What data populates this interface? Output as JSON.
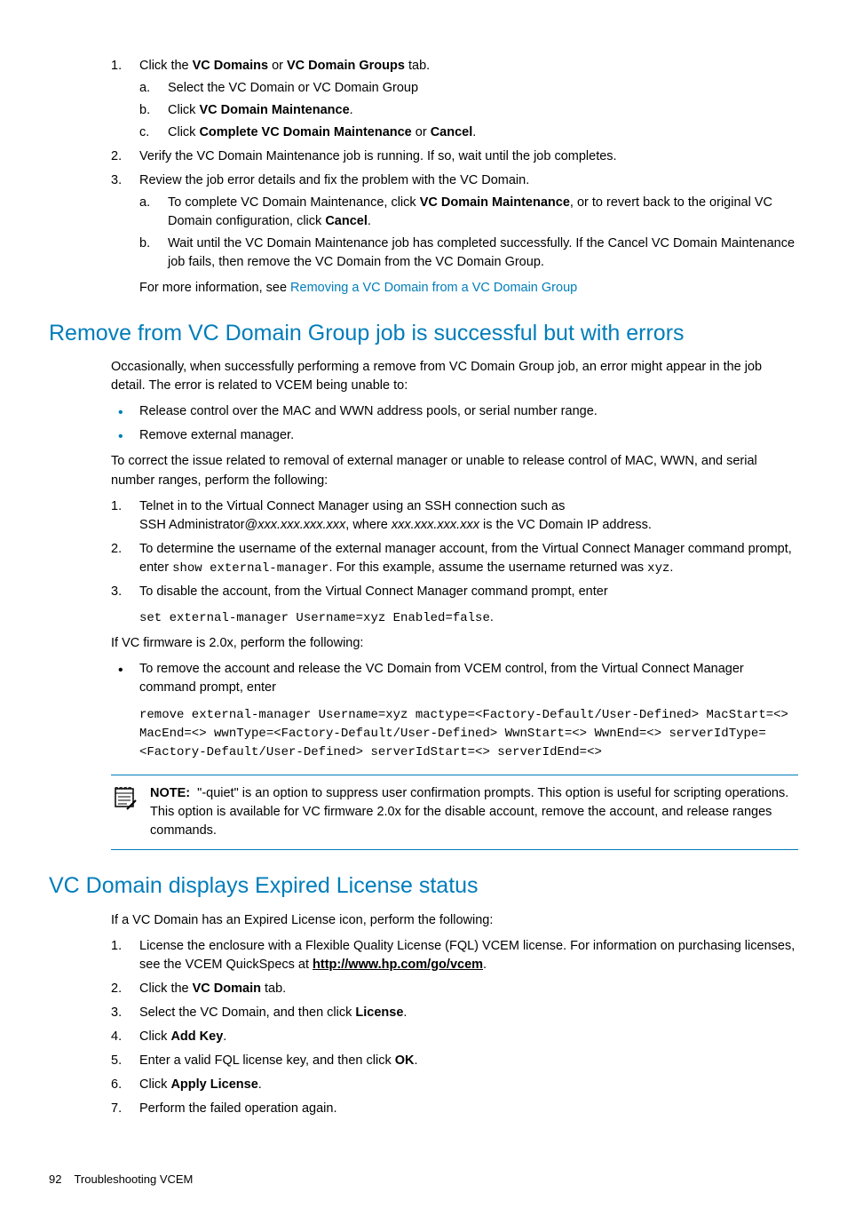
{
  "step1": {
    "text_a": "Click the ",
    "b1": "VC Domains",
    "text_b": " or ",
    "b2": "VC Domain Groups",
    "text_c": " tab.",
    "sub_a": "Select the VC Domain or VC Domain Group",
    "sub_b_a": "Click ",
    "sub_b_b": "VC Domain Maintenance",
    "sub_b_c": ".",
    "sub_c_a": "Click ",
    "sub_c_b": "Complete VC Domain Maintenance",
    "sub_c_c": " or ",
    "sub_c_d": "Cancel",
    "sub_c_e": "."
  },
  "step2": "Verify the VC Domain Maintenance job is running. If so, wait until the job completes.",
  "step3": {
    "text": "Review the job error details and fix the problem with the VC Domain.",
    "sub_a_a": "To complete VC Domain Maintenance, click ",
    "sub_a_b": "VC Domain Maintenance",
    "sub_a_c": ", or to revert back to the original VC Domain configuration, click ",
    "sub_a_d": "Cancel",
    "sub_a_e": ".",
    "sub_b": "Wait until the VC Domain Maintenance job has completed successfully. If the Cancel VC Domain Maintenance job fails, then remove the VC Domain from the VC Domain Group.",
    "moreinfo_a": "For more information, see ",
    "moreinfo_link": "Removing a VC Domain from a VC Domain Group"
  },
  "h_remove": "Remove from VC Domain Group job is successful but with errors",
  "remove_intro": "Occasionally, when successfully performing a remove from VC Domain Group job, an error might appear in the job detail. The error is related to VCEM being unable to:",
  "remove_b1": "Release control over the MAC and WWN address pools, or serial number range.",
  "remove_b2": "Remove external manager.",
  "remove_correct": "To correct the issue related to removal of external manager or unable to release control of MAC, WWN, and serial number ranges, perform the following:",
  "rstep1_a": "Telnet in to the Virtual Connect Manager using an SSH connection such as",
  "rstep1_b": "SSH Administrator@",
  "rstep1_c": "xxx.xxx.xxx.xxx",
  "rstep1_d": ", where ",
  "rstep1_e": "xxx.xxx.xxx.xxx",
  "rstep1_f": " is the VC Domain IP address.",
  "rstep2_a": "To determine the username of the external manager account, from the Virtual Connect Manager command prompt, enter ",
  "rstep2_b": "show external-manager",
  "rstep2_c": ". For this example, assume the username returned was ",
  "rstep2_d": "xyz",
  "rstep2_e": ".",
  "rstep3": "To disable the account, from the Virtual Connect Manager command prompt, enter",
  "rstep3_code": "set external-manager Username=xyz Enabled=false",
  "rstep3_dot": ".",
  "fw20": "If VC firmware is 2.0x, perform the following:",
  "fw_bullet": "To remove the account and release the VC Domain from VCEM control, from the Virtual Connect Manager command prompt, enter",
  "fw_code": "remove external-manager Username=xyz mactype=<Factory-Default/User-Defined> MacStart=<> MacEnd=<> wwnType=<Factory-Default/User-Defined> WwnStart=<> WwnEnd=<> serverIdType=<Factory-Default/User-Defined> serverIdStart=<> serverIdEnd=<>",
  "note_label": "NOTE:",
  "note_text": "\"-quiet\" is an option to suppress user confirmation prompts. This option is useful for scripting operations. This option is available for VC firmware 2.0x for the disable account, remove the account, and release ranges commands.",
  "h_expired": "VC Domain displays Expired License status",
  "exp_intro": "If a VC Domain has an Expired License icon, perform the following:",
  "exp1_a": "License the enclosure with a Flexible Quality License (FQL) VCEM license. For information on purchasing licenses, see the VCEM QuickSpecs at ",
  "exp1_url": "http://www.hp.com/go/vcem",
  "exp1_b": ".",
  "exp2_a": "Click the ",
  "exp2_b": "VC Domain",
  "exp2_c": " tab.",
  "exp3_a": "Select the VC Domain, and then click ",
  "exp3_b": "License",
  "exp3_c": ".",
  "exp4_a": "Click ",
  "exp4_b": "Add Key",
  "exp4_c": ".",
  "exp5_a": "Enter a valid FQL license key, and then click ",
  "exp5_b": "OK",
  "exp5_c": ".",
  "exp6_a": "Click ",
  "exp6_b": "Apply License",
  "exp6_c": ".",
  "exp7": "Perform the failed operation again.",
  "footer_num": "92",
  "footer_text": "Troubleshooting VCEM"
}
